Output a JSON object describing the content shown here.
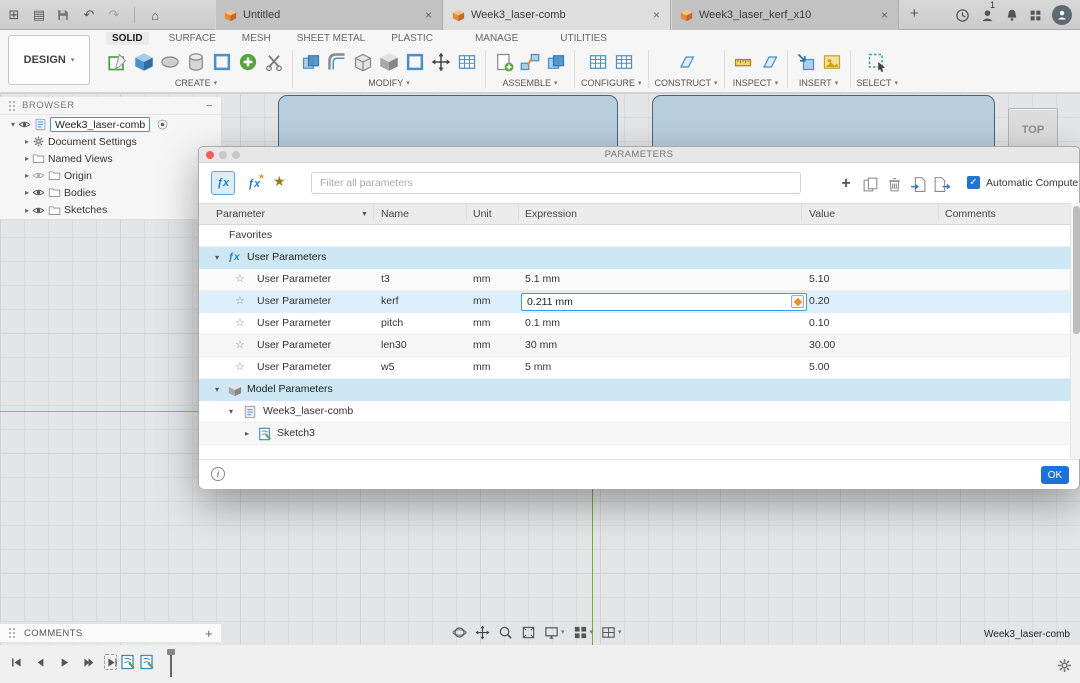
{
  "icons": {
    "caret": "▾",
    "close": "×",
    "plus": "+",
    "minus": "−",
    "tri_right": "▸",
    "tri_down": "▾",
    "star_outline": "☆",
    "star_filled": "★",
    "sort_desc": "▼",
    "check": "✓",
    "info": "i",
    "fx": "ƒx",
    "undo": "↶",
    "redo": "↷",
    "home": "⌂",
    "apps": "⊞",
    "panel": "▤"
  },
  "titlebar": {
    "tabs": [
      {
        "label": "Untitled"
      },
      {
        "label": "Week3_laser-comb"
      },
      {
        "label": "Week3_laser_kerf_x10"
      }
    ],
    "user_badge": "1"
  },
  "ribbon": {
    "design": "DESIGN",
    "tabs": [
      "SOLID",
      "SURFACE",
      "MESH",
      "SHEET METAL",
      "PLASTIC",
      "MANAGE",
      "UTILITIES"
    ],
    "groups": [
      "CREATE",
      "MODIFY",
      "ASSEMBLE",
      "CONFIGURE",
      "CONSTRUCT",
      "INSPECT",
      "INSERT",
      "SELECT"
    ]
  },
  "browser": {
    "title": "BROWSER",
    "root": "Week3_laser-comb",
    "items": [
      "Document Settings",
      "Named Views",
      "Origin",
      "Bodies",
      "Sketches"
    ]
  },
  "viewcube": {
    "face": "TOP"
  },
  "dialog": {
    "title": "PARAMETERS",
    "filter_placeholder": "Filter all parameters",
    "auto_compute_label": "Automatic Compute",
    "columns": {
      "parameter": "Parameter",
      "name": "Name",
      "unit": "Unit",
      "expression": "Expression",
      "value": "Value",
      "comments": "Comments"
    },
    "favorites_label": "Favorites",
    "groups": {
      "user": "User Parameters",
      "model": "Model Parameters"
    },
    "rows": [
      {
        "parameter": "User Parameter",
        "name": "t3",
        "unit": "mm",
        "expression": "5.1 mm",
        "value": "5.10"
      },
      {
        "parameter": "User Parameter",
        "name": "kerf",
        "unit": "mm",
        "expression": "0.211 mm",
        "value": "0.20"
      },
      {
        "parameter": "User Parameter",
        "name": "pitch",
        "unit": "mm",
        "expression": "0.1 mm",
        "value": "0.10"
      },
      {
        "parameter": "User Parameter",
        "name": "len30",
        "unit": "mm",
        "expression": "30 mm",
        "value": "30.00"
      },
      {
        "parameter": "User Parameter",
        "name": "w5",
        "unit": "mm",
        "expression": "5 mm",
        "value": "5.00"
      }
    ],
    "model_tree": {
      "component": "Week3_laser-comb",
      "sketch": "Sketch3"
    },
    "ok_label": "OK"
  },
  "comments": {
    "label": "COMMENTS"
  },
  "status": {
    "doc_name": "Week3_laser-comb"
  },
  "colors": {
    "accent": "#1b72d8",
    "selection": "#ddeffb",
    "group_row": "#cde7f5"
  }
}
